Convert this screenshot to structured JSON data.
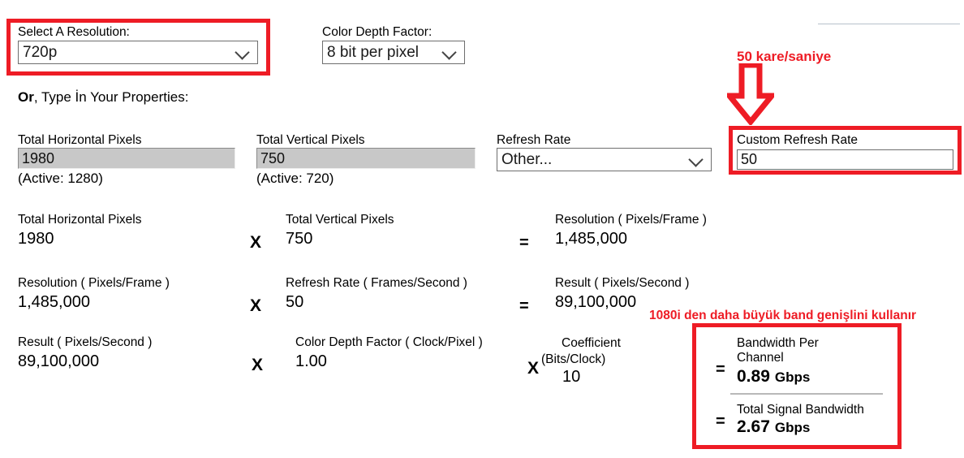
{
  "resolution_select": {
    "label": "Select A Resolution:",
    "value": "720p",
    "icon": "chevron-down-icon"
  },
  "color_depth_select": {
    "label": "Color Depth Factor:",
    "value": "8 bit per pixel",
    "icon": "chevron-down-icon"
  },
  "or_line": {
    "bold": "Or",
    "rest": ", Type İn Your Properties:"
  },
  "inputs": {
    "horizontal": {
      "label": "Total Horizontal Pixels",
      "value": "1980",
      "active_note": "(Active: 1280)"
    },
    "vertical": {
      "label": "Total Vertical Pixels",
      "value": "750",
      "active_note": "(Active: 720)"
    },
    "refresh_rate": {
      "label": "Refresh Rate",
      "value": "Other...",
      "icon": "chevron-down-icon"
    },
    "custom_refresh_rate": {
      "label": "Custom Refresh Rate",
      "value": "50"
    }
  },
  "calc_rows": [
    {
      "a_label": "Total Horizontal Pixels",
      "a_value": "1980",
      "op1": "X",
      "b_label": "Total Vertical Pixels",
      "b_value": "750",
      "op2": "=",
      "c_label": "Resolution ( Pixels/Frame )",
      "c_value": "1,485,000"
    },
    {
      "a_label": "Resolution ( Pixels/Frame )",
      "a_value": "1,485,000",
      "op1": "X",
      "b_label": "Refresh Rate ( Frames/Second )",
      "b_value": "50",
      "op2": "=",
      "c_label": "Result ( Pixels/Second )",
      "c_value": "89,100,000"
    }
  ],
  "calc_row3": {
    "a_label": "Result ( Pixels/Second )",
    "a_value": "89,100,000",
    "op1": "X",
    "b_label": "Color Depth Factor ( Clock/Pixel )",
    "b_value": "1.00",
    "op2": "X",
    "c_label_line1": "Coefficient",
    "c_label_line2": "(Bits/Clock)",
    "c_value": "10"
  },
  "results": {
    "eq1": "=",
    "channel_label_line1": "Bandwidth Per",
    "channel_label_line2": "Channel",
    "channel_value": "0.89",
    "channel_unit": "Gbps",
    "eq2": "=",
    "total_label": "Total Signal Bandwidth",
    "total_value": "2.67",
    "total_unit": "Gbps"
  },
  "annotations": {
    "top_right": "50 kare/saniye",
    "mid_right": "1080i den daha büyük band genişlini kullanır",
    "arrow_icon": "arrow-down-icon"
  },
  "colors": {
    "highlight_red": "#ee1c25",
    "disabled_field": "#c8c8c8",
    "divider_gray": "#b8c2cc"
  }
}
